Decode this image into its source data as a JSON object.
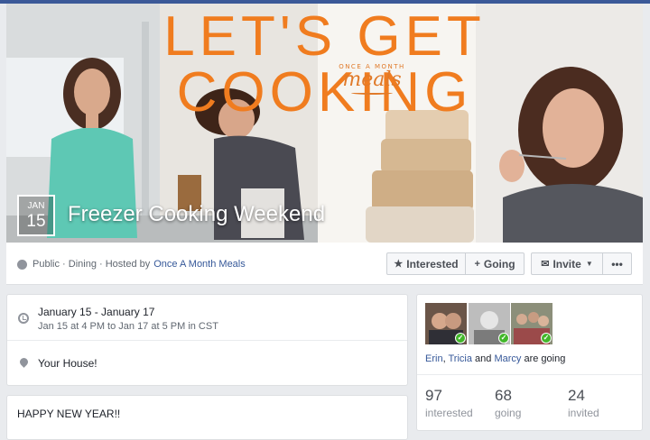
{
  "cover": {
    "headline": "LET'S GET COOKING",
    "brand_small": "ONCE A MONTH",
    "brand_big": "meals"
  },
  "event": {
    "month": "JAN",
    "day": "15",
    "title": "Freezer Cooking Weekend"
  },
  "info": {
    "privacy": "Public",
    "category": "Dining",
    "hosted_by_prefix": "Hosted by",
    "host": "Once A Month Meals"
  },
  "actions": {
    "interested_label": "Interested",
    "going_label": "Going",
    "invite_label": "Invite",
    "more_label": "•••"
  },
  "when": {
    "range": "January 15 - January 17",
    "detail": "Jan 15 at 4 PM to Jan 17 at 5 PM in CST"
  },
  "where": {
    "location": "Your House!"
  },
  "description": {
    "text": "HAPPY NEW YEAR!!"
  },
  "guests": {
    "name1": "Erin",
    "name2": "Tricia",
    "and": "and",
    "name3": "Marcy",
    "suffix": "are going",
    "stats": [
      {
        "value": "97",
        "label": "interested"
      },
      {
        "value": "68",
        "label": "going"
      },
      {
        "value": "24",
        "label": "invited"
      }
    ]
  },
  "colors": {
    "brand_orange": "#f07c1f",
    "link_blue": "#365899",
    "going_check": "#42b72a"
  }
}
